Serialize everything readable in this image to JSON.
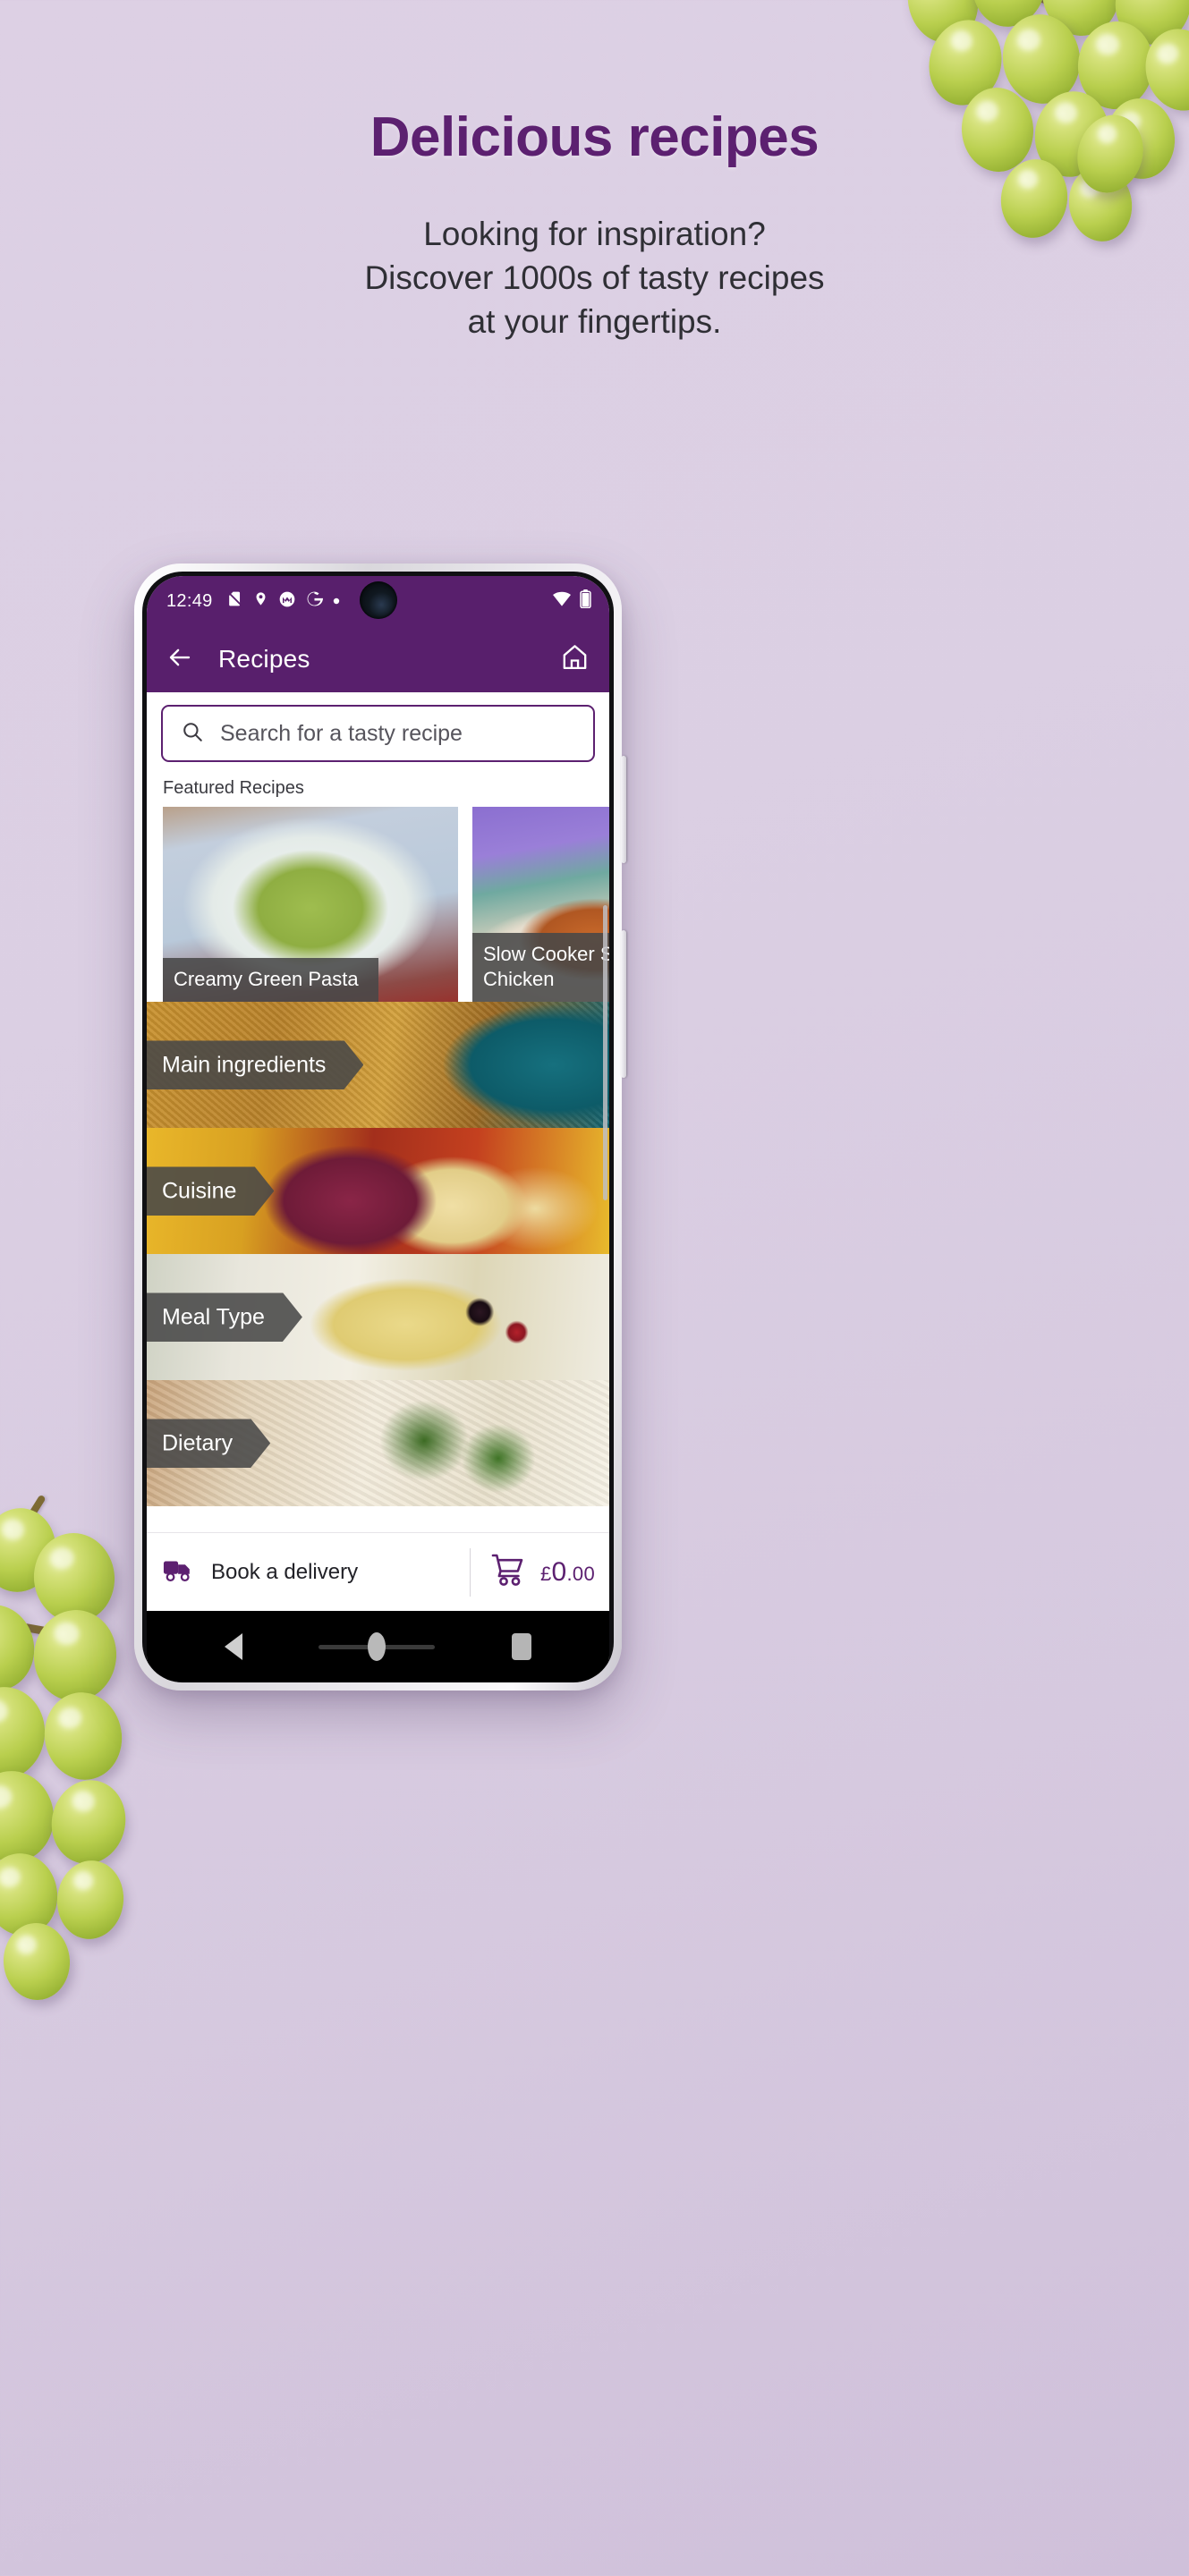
{
  "hero": {
    "title": "Delicious recipes",
    "subtitle": "Looking for inspiration?\nDiscover 1000s of tasty recipes\nat your fingertips."
  },
  "colors": {
    "brand_purple": "#581f6c",
    "brand_purple_dark": "#5c2070",
    "page_background": "#d9cce2",
    "overlay_grey": "rgba(72,72,72,0.88)"
  },
  "phone": {
    "status_bar": {
      "time": "12:49",
      "left_icons": [
        "no-sim-icon",
        "location-icon",
        "motorola-icon",
        "google-icon",
        "dot-icon"
      ],
      "right_icons": [
        "wifi-icon",
        "battery-icon"
      ]
    },
    "app_bar": {
      "back_label": "back-arrow-icon",
      "title": "Recipes",
      "home_label": "home-icon"
    },
    "search": {
      "placeholder": "Search for a tasty recipe",
      "value": "",
      "icon": "search-icon"
    },
    "featured": {
      "section_label": "Featured Recipes",
      "cards": [
        {
          "title": "Creamy Green Pasta",
          "photo": "ph-pasta"
        },
        {
          "title": "Slow Cooker Sticky Chicken",
          "photo": "ph-chicken"
        }
      ]
    },
    "categories": [
      {
        "label": "Main ingredients",
        "photo": "ph-crumble"
      },
      {
        "label": "Cuisine",
        "photo": "ph-cuisine"
      },
      {
        "label": "Meal Type",
        "photo": "ph-dessert"
      },
      {
        "label": "Dietary",
        "photo": "ph-dietary"
      }
    ],
    "bottom_bar": {
      "delivery_label": "Book a delivery",
      "delivery_icon": "delivery-truck-icon",
      "cart_icon": "shopping-cart-icon",
      "cart_currency": "£",
      "cart_pounds": "0",
      "cart_pence": ".00"
    },
    "android_nav": {
      "back": "nav-back-icon",
      "home": "nav-home-icon",
      "recents": "nav-recents-icon"
    }
  }
}
